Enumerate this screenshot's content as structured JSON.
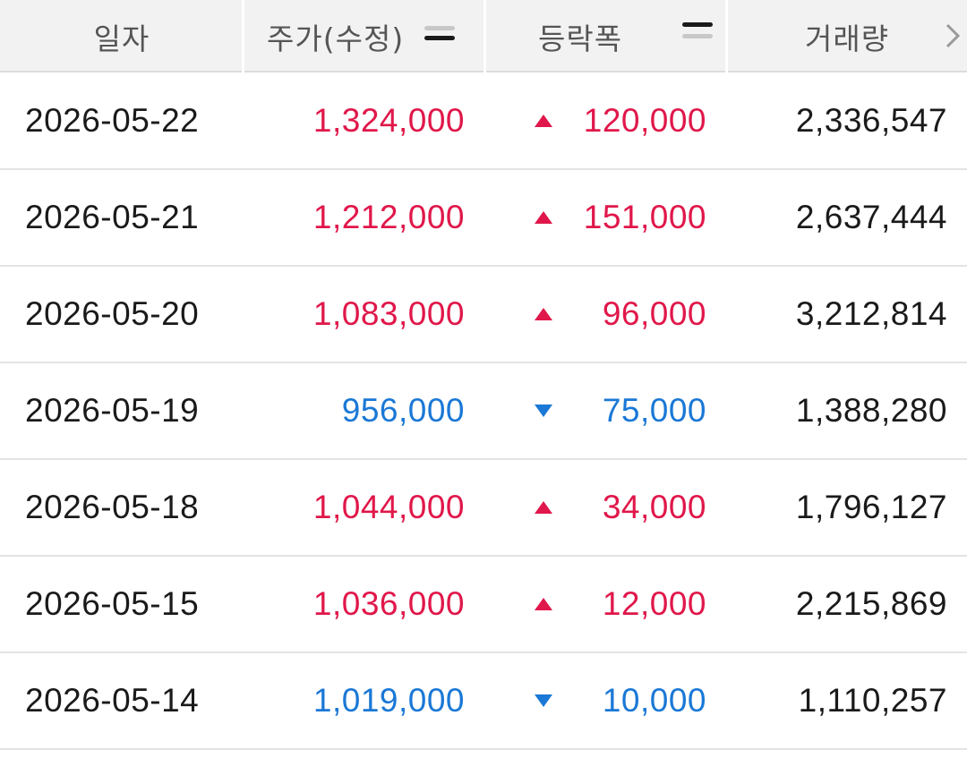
{
  "header": {
    "date_label": "일자",
    "price_label": "주가(수정)",
    "change_label": "등락폭",
    "volume_label": "거래량",
    "more_icon": "chevron-right-icon"
  },
  "colors": {
    "up": "#e0174a",
    "down": "#1a78d6",
    "text": "#1a1a1a",
    "header_bg": "#f2f2f2"
  },
  "rows": [
    {
      "date": "2026-05-22",
      "price": "1,324,000",
      "direction": "up",
      "change": "120,000",
      "volume": "2,336,547"
    },
    {
      "date": "2026-05-21",
      "price": "1,212,000",
      "direction": "up",
      "change": "151,000",
      "volume": "2,637,444"
    },
    {
      "date": "2026-05-20",
      "price": "1,083,000",
      "direction": "up",
      "change": "96,000",
      "volume": "3,212,814"
    },
    {
      "date": "2026-05-19",
      "price": "956,000",
      "direction": "down",
      "change": "75,000",
      "volume": "1,388,280"
    },
    {
      "date": "2026-05-18",
      "price": "1,044,000",
      "direction": "up",
      "change": "34,000",
      "volume": "1,796,127"
    },
    {
      "date": "2026-05-15",
      "price": "1,036,000",
      "direction": "up",
      "change": "12,000",
      "volume": "2,215,869"
    },
    {
      "date": "2026-05-14",
      "price": "1,019,000",
      "direction": "down",
      "change": "10,000",
      "volume": "1,110,257"
    }
  ]
}
